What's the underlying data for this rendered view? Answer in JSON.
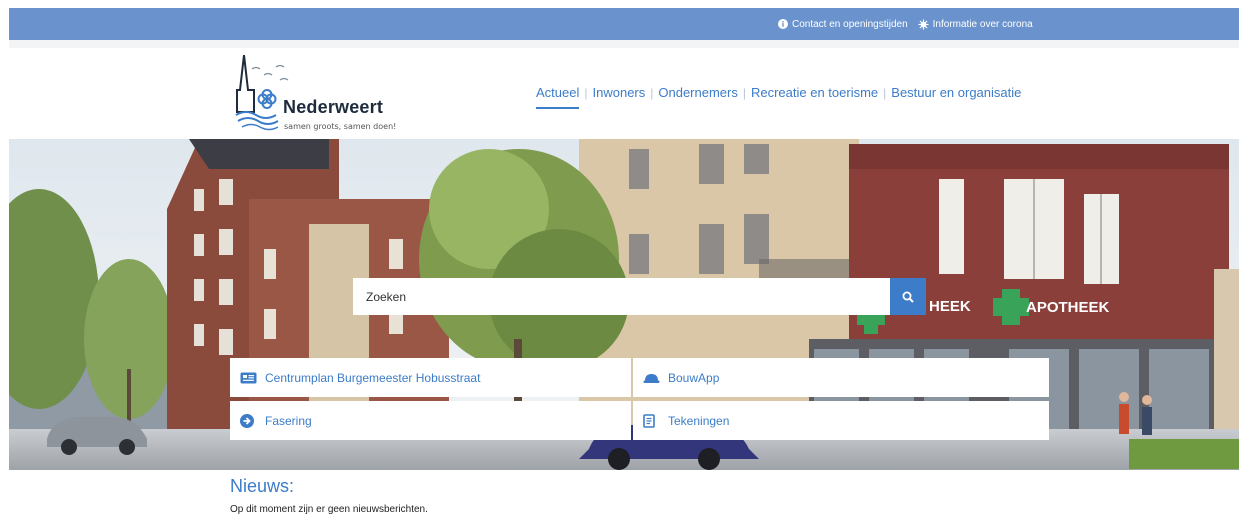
{
  "topbar": {
    "links": [
      {
        "label": "Contact en openingstijden",
        "icon": "info-circle-icon"
      },
      {
        "label": "Informatie over corona",
        "icon": "virus-icon"
      }
    ]
  },
  "logo": {
    "name": "Nederweert",
    "tagline": "samen groots, samen doen!"
  },
  "nav": {
    "items": [
      {
        "label": "Actueel",
        "active": true
      },
      {
        "label": "Inwoners"
      },
      {
        "label": "Ondernemers"
      },
      {
        "label": "Recreatie en toerisme"
      },
      {
        "label": "Bestuur en organisatie"
      }
    ]
  },
  "hero": {
    "sign_text": "APOTHEEK",
    "sign_text_partial": "HEEK"
  },
  "search": {
    "placeholder": "Zoeken",
    "button_icon": "search-icon"
  },
  "tiles": [
    {
      "label": "Centrumplan Burgemeester Hobusstraat",
      "icon": "newspaper-icon"
    },
    {
      "label": "BouwApp",
      "icon": "hard-hat-icon"
    },
    {
      "label": "Fasering",
      "icon": "arrow-circle-right-icon"
    },
    {
      "label": "Tekeningen",
      "icon": "document-icon"
    }
  ],
  "news": {
    "title": "Nieuws:",
    "empty_message": "Op dit moment zijn er geen nieuwsberichten."
  },
  "colors": {
    "topbar": "#6a93cd",
    "accent": "#3c7cc8",
    "text": "#333333"
  }
}
